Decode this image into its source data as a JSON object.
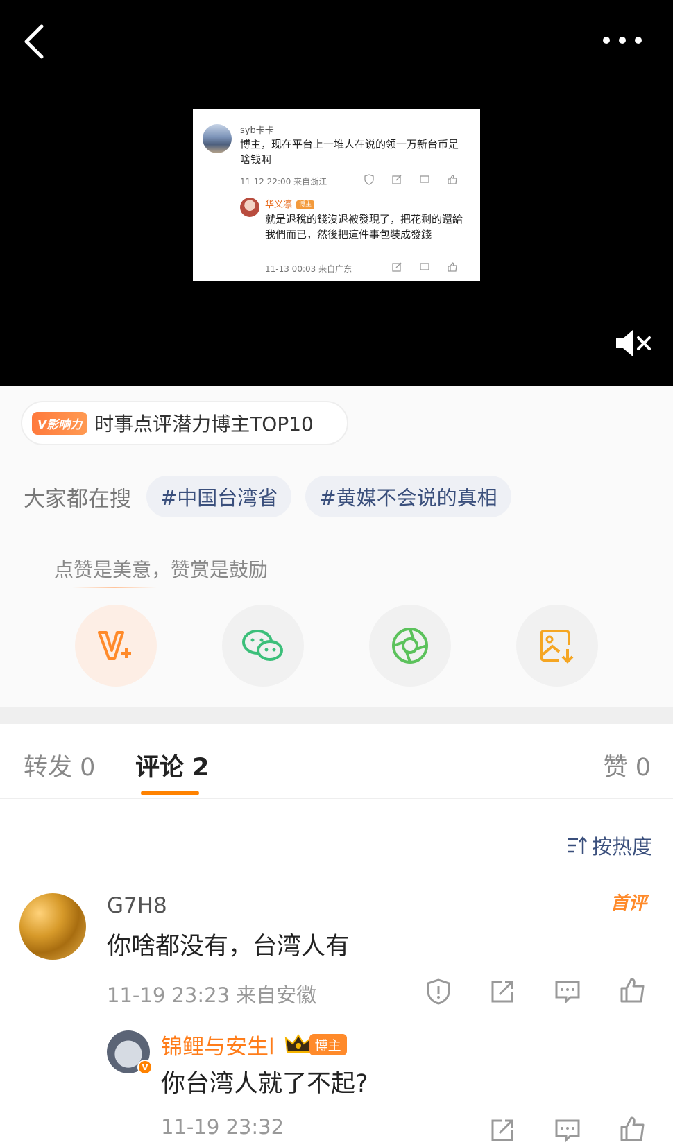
{
  "embedded_screenshot": {
    "comment_user": "syb卡卡",
    "comment_text": "博主，现在平台上一堆人在说的领一万新台币是啥钱啊",
    "comment_meta": "11-12 22:00  来自浙江",
    "reply_user": "华义凛",
    "reply_badge": "博主",
    "reply_text": "就是退稅的錢沒退被發現了，把花剩的還給我們而已，然後把這件事包裝成發錢",
    "reply_meta": "11-13 00:03  来自广东"
  },
  "influence_badge": {
    "tag": "V影响力",
    "text": "时事点评潜力博主TOP10"
  },
  "search": {
    "label": "大家都在搜",
    "topics": [
      "#中国台湾省",
      "#黄媒不会说的真相"
    ]
  },
  "reward": {
    "tip": "点赞是美意，赞赏是鼓励",
    "buttons": [
      "v-plus-icon",
      "wechat-icon",
      "moments-icon",
      "save-image-icon"
    ]
  },
  "tabs": {
    "repost": "转发 0",
    "comments": "评论 2",
    "likes": "赞 0"
  },
  "sort_label": "按热度",
  "comments": [
    {
      "user": "G7H8",
      "tag": "首评",
      "text": "你啥都没有，台湾人有",
      "meta": "11-19 23:23  来自安徽"
    },
    {
      "user": "锦鲤与安生l",
      "badge": "博主",
      "text": "你台湾人就了不起?",
      "meta": "11-19 23:32"
    }
  ],
  "colors": {
    "accent": "#ff8200",
    "link": "#3a4f7c",
    "video_bg": "#000000"
  }
}
